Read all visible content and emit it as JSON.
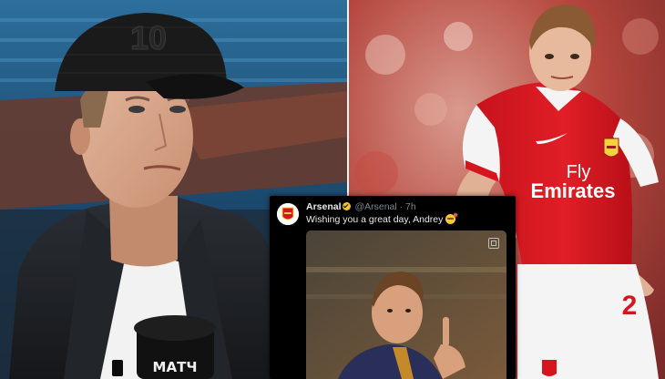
{
  "tweet": {
    "account_name": "Arsenal",
    "handle_time": "@Arsenal · 7h",
    "text": "Wishing you a great day, Andrey",
    "emoji_icon": "partying-face-emoji"
  },
  "left_photo": {
    "cap_number": "10",
    "mic_label": "МАТЧ"
  },
  "right_photo": {
    "shirt_sponsor_line1": "Fly",
    "shirt_sponsor_line2": "Emirates",
    "shirt_number": "2",
    "crest_icon": "arsenal-crest-icon",
    "maker_icon": "nike-swoosh-icon"
  },
  "colors": {
    "arsenal_red": "#d6161e",
    "cap_black": "#1a1a1a",
    "tweet_bg": "#000000",
    "stadium_blue": "#1f5f8f"
  }
}
